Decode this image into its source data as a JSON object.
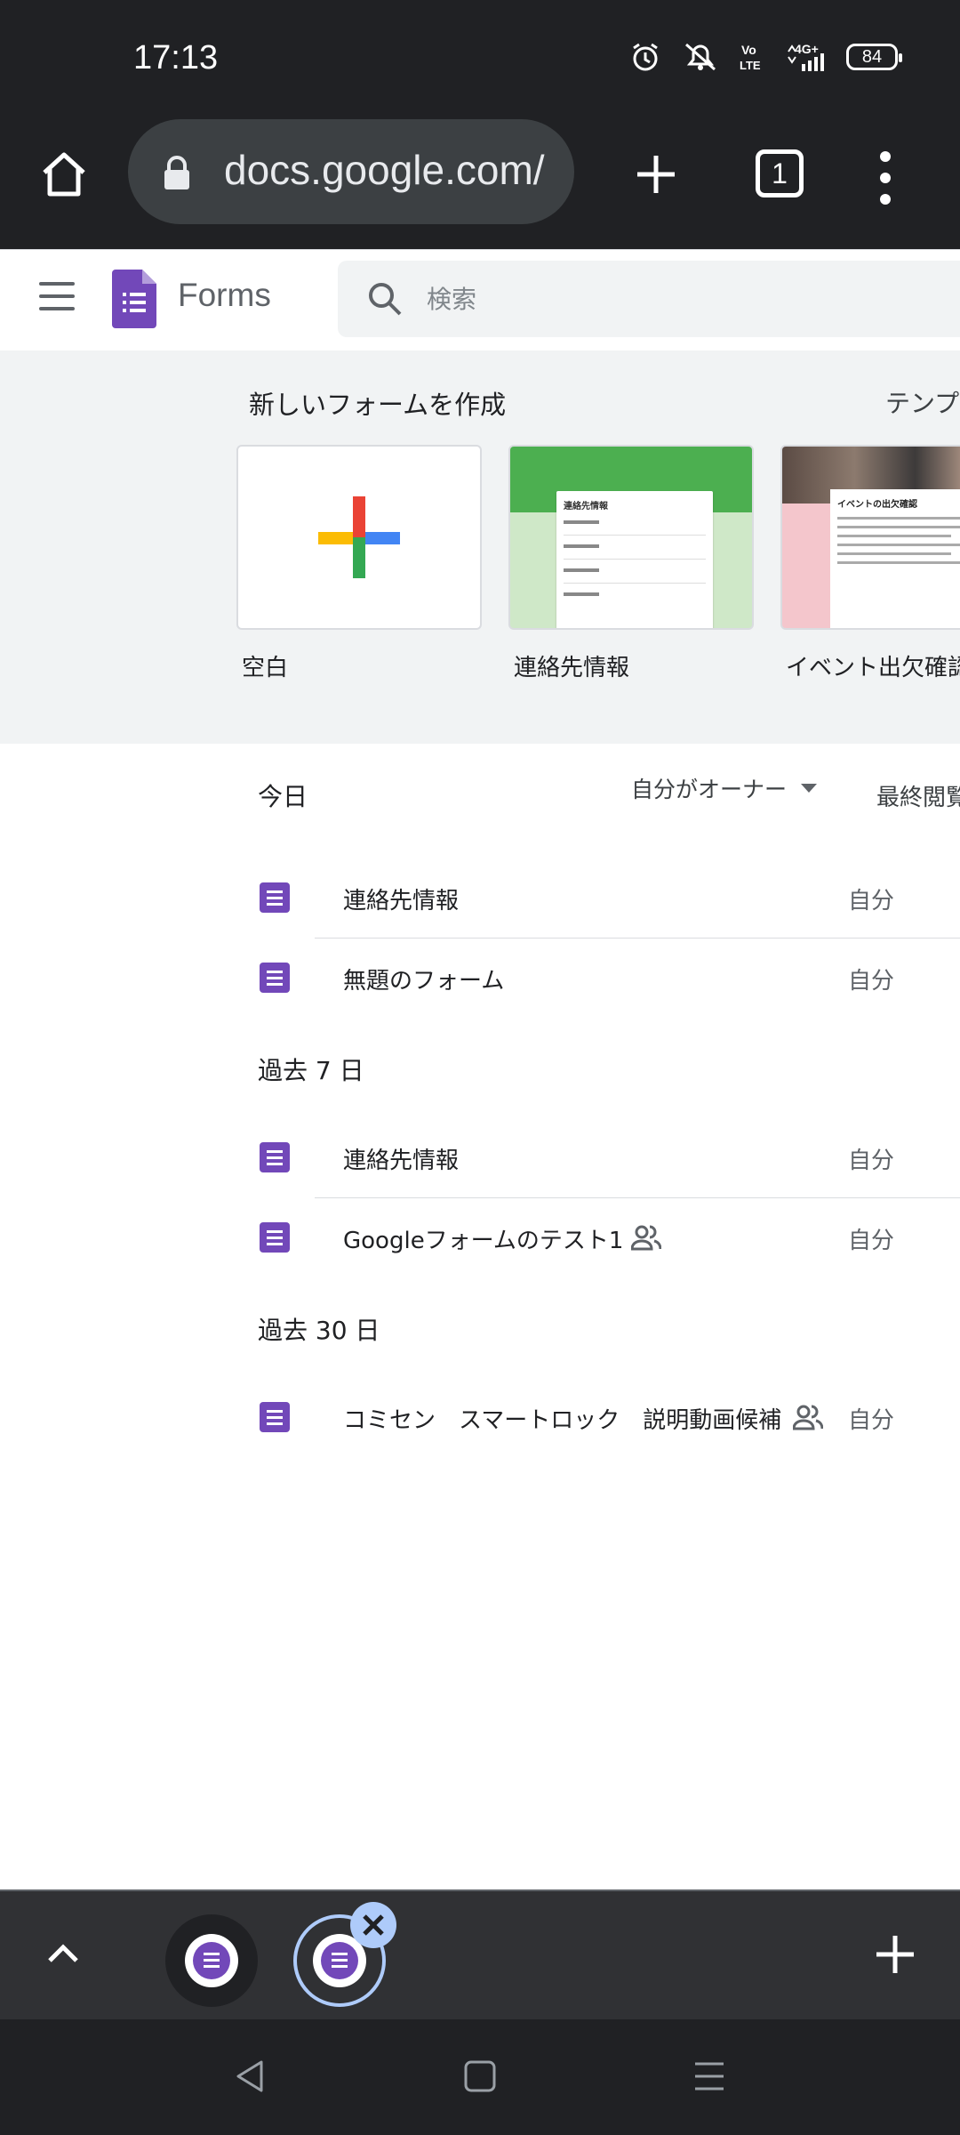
{
  "status_bar": {
    "time": "17:13",
    "battery": "84",
    "icons": [
      "alarm-icon",
      "mute-icon",
      "volte-icon",
      "signal-4g-icon",
      "battery-icon"
    ]
  },
  "browser": {
    "url": "docs.google.com/",
    "tab_count": "1",
    "icons": [
      "home-icon",
      "lock-icon",
      "plus-icon",
      "overflow-menu-icon"
    ]
  },
  "app_header": {
    "app_name": "Forms",
    "search_placeholder": "検索"
  },
  "template_gallery": {
    "title": "新しいフォームを作成",
    "gallery_link": "テンプレ",
    "templates": [
      {
        "label": "空白"
      },
      {
        "label": "連絡先情報",
        "preview_title": "連絡先情報"
      },
      {
        "label": "イベント出欠確認",
        "preview_title": "イベントの出欠確認"
      }
    ]
  },
  "recent": {
    "owner_filter": "自分がオーナー",
    "sort_label": "最終閲覧",
    "sections": [
      {
        "label": "今日",
        "items": [
          {
            "title": "連絡先情報",
            "owner": "自分",
            "shared": false
          },
          {
            "title": "無題のフォーム",
            "owner": "自分",
            "shared": false
          }
        ]
      },
      {
        "label": "過去 7 日",
        "items": [
          {
            "title": "連絡先情報",
            "owner": "自分",
            "shared": false
          },
          {
            "title": "Googleフォームのテスト1",
            "owner": "自分",
            "shared": true
          }
        ]
      },
      {
        "label": "過去 30 日",
        "items": [
          {
            "title": "コミセン　スマートロック　説明動画候補",
            "owner": "自分",
            "shared": true
          }
        ]
      }
    ]
  },
  "tab_strip": {
    "icons": [
      "chevron-up-icon",
      "forms-tab-icon",
      "close-icon",
      "plus-icon"
    ]
  },
  "nav_bar": {
    "icons": [
      "back-icon",
      "home-icon",
      "recents-icon"
    ]
  },
  "colors": {
    "forms_purple": "#7248b9",
    "browser_dark": "#202124",
    "gallery_bg": "#f1f3f4",
    "tab_active_ring": "#aecbfa"
  }
}
